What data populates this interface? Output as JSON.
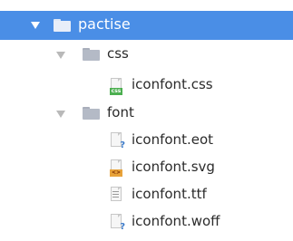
{
  "tree": {
    "root": {
      "label": "pactise",
      "icon": "folder-icon",
      "expanded": true,
      "selected": true
    },
    "css_folder": {
      "label": "css",
      "icon": "folder-icon",
      "expanded": true
    },
    "css_files": [
      {
        "label": "iconfont.css",
        "icon": "css-file-icon",
        "badge": "css"
      }
    ],
    "font_folder": {
      "label": "font",
      "icon": "folder-icon",
      "expanded": true
    },
    "font_files": [
      {
        "label": "iconfont.eot",
        "icon": "unknown-file-icon",
        "badge": "?"
      },
      {
        "label": "iconfont.svg",
        "icon": "svg-file-icon",
        "badge": "<>"
      },
      {
        "label": "iconfont.ttf",
        "icon": "text-file-icon"
      },
      {
        "label": "iconfont.woff",
        "icon": "unknown-file-icon",
        "badge": "?"
      }
    ]
  },
  "colors": {
    "selection": "#4a8ee6",
    "css_badge": "#4caf50",
    "svg_badge": "#e8a33a",
    "unknown_badge": "#3c7ac9"
  }
}
